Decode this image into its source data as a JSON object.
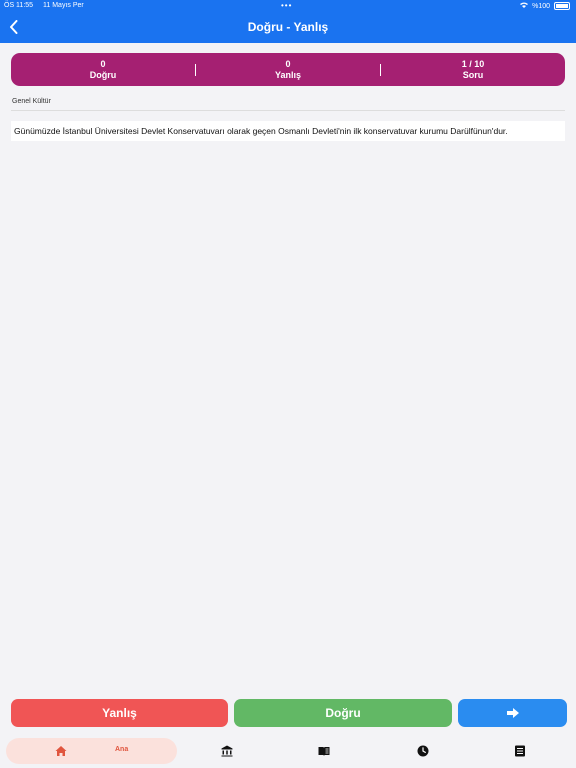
{
  "status": {
    "time": "ÖS 11:55",
    "date": "11 Mayıs Per",
    "battery": "%100"
  },
  "header": {
    "title": "Doğru - Yanlış"
  },
  "score": {
    "correct_value": "0",
    "correct_label": "Doğru",
    "wrong_value": "0",
    "wrong_label": "Yanlış",
    "question_value": "1 / 10",
    "question_label": "Soru"
  },
  "quiz": {
    "category": "Genel Kültür",
    "question": "Günümüzde İstanbul Üniversitesi Devlet Konservatuvarı olarak geçen Osmanlı Devleti'nin ilk konservatuvar kurumu Darülfünun'dur."
  },
  "actions": {
    "false_label": "Yanlış",
    "true_label": "Doğru",
    "next_icon": "arrow-right-icon"
  },
  "tabs": {
    "home_label": "Ana",
    "icons": [
      "home-icon",
      "bank-icon",
      "book-icon",
      "clock-icon",
      "list-icon"
    ]
  },
  "colors": {
    "header": "#1a73f0",
    "scorebar": "#a52072",
    "false_button": "#f05555",
    "true_button": "#62b865",
    "next_button": "#2a8cf0",
    "home_tab_bg": "#fbe1dc",
    "home_tab_accent": "#e0553e"
  }
}
